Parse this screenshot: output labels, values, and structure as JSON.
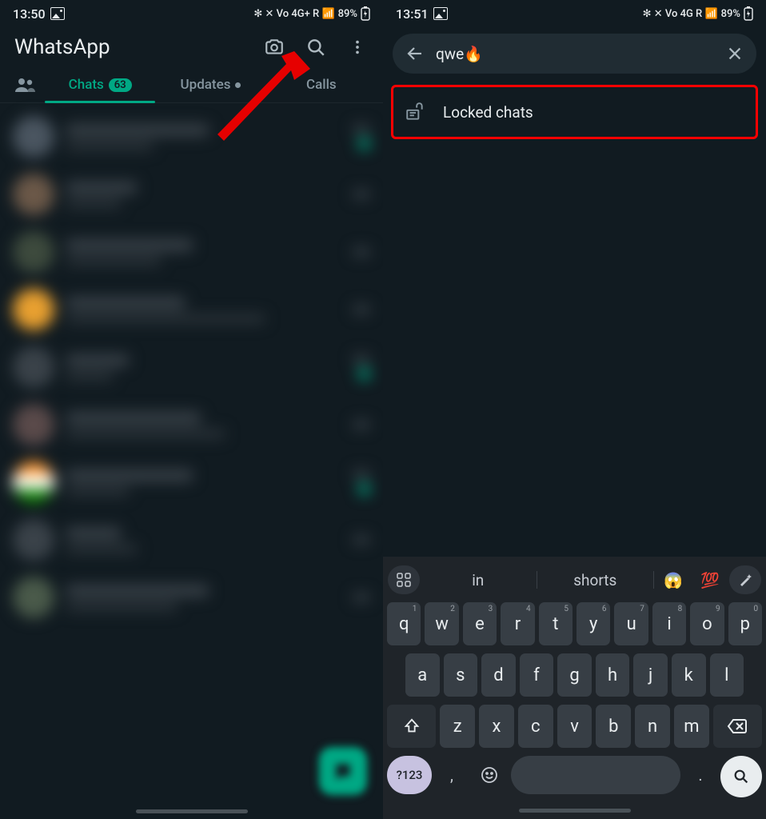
{
  "left": {
    "status": {
      "time": "13:50",
      "indicators": "✻ ✕ Vo 4G+ R 📶 ",
      "battery": "89%"
    },
    "appTitle": "WhatsApp",
    "tabs": {
      "chats": "Chats",
      "chatsBadge": "63",
      "updates": "Updates",
      "calls": "Calls"
    }
  },
  "right": {
    "status": {
      "time": "13:51",
      "indicators": "✻ ✕ Vo 4G R 📶 ",
      "battery": "89%"
    },
    "search": {
      "value": "qwe🔥"
    },
    "result": {
      "label": "Locked chats"
    },
    "suggestions": {
      "w1": "in",
      "w2": "shorts",
      "e1": "😱",
      "e2": "💯"
    },
    "keys": {
      "row1": [
        "q",
        "w",
        "e",
        "r",
        "t",
        "y",
        "u",
        "i",
        "o",
        "p"
      ],
      "nums": [
        "1",
        "2",
        "3",
        "4",
        "5",
        "6",
        "7",
        "8",
        "9",
        "0"
      ],
      "row2": [
        "a",
        "s",
        "d",
        "f",
        "g",
        "h",
        "j",
        "k",
        "l"
      ],
      "row3": [
        "z",
        "x",
        "c",
        "v",
        "b",
        "n",
        "m"
      ],
      "sym": "?123",
      "comma": ",",
      "period": "."
    }
  }
}
